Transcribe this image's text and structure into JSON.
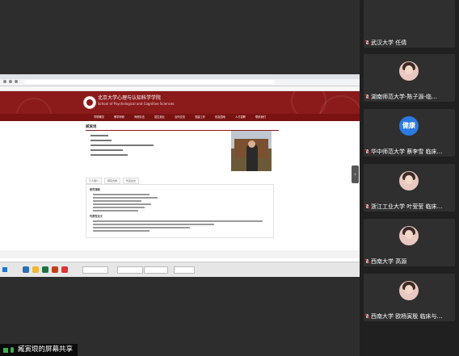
{
  "website": {
    "title_cn": "北京大学心理与认知科学学院",
    "title_en": "School of Psychological and Cognitive Sciences",
    "nav_items": [
      "学院概况",
      "教学科研",
      "师资队伍",
      "招生就业",
      "合作交流",
      "党建工作",
      "校友园地",
      "人才招聘",
      "联系我们"
    ],
    "person_name": "臧寅垠",
    "tabs": [
      "个人简介",
      "研究方向",
      "代表论文"
    ],
    "section_research": "研究领域",
    "section_papers": "代表性论文"
  },
  "share": {
    "sharer_text": "臧寅垠的屏幕共享"
  },
  "participants": [
    {
      "name": "武汉大学 任倩",
      "avatar": "none"
    },
    {
      "name": "湖南师范大学-陈子源-临…",
      "avatar": "photo"
    },
    {
      "name": "华中师范大学 蔡李雪 临床…",
      "avatar": "text",
      "avatar_text": "健康",
      "avatar_color": "#2d7ae0"
    },
    {
      "name": "浙江工业大学 叶莹莹 临床…",
      "avatar": "photo"
    },
    {
      "name": "西南大学 高源",
      "avatar": "photo"
    },
    {
      "name": "西南大学 欧杨寅殷 临床与…",
      "avatar": "photo"
    }
  ]
}
